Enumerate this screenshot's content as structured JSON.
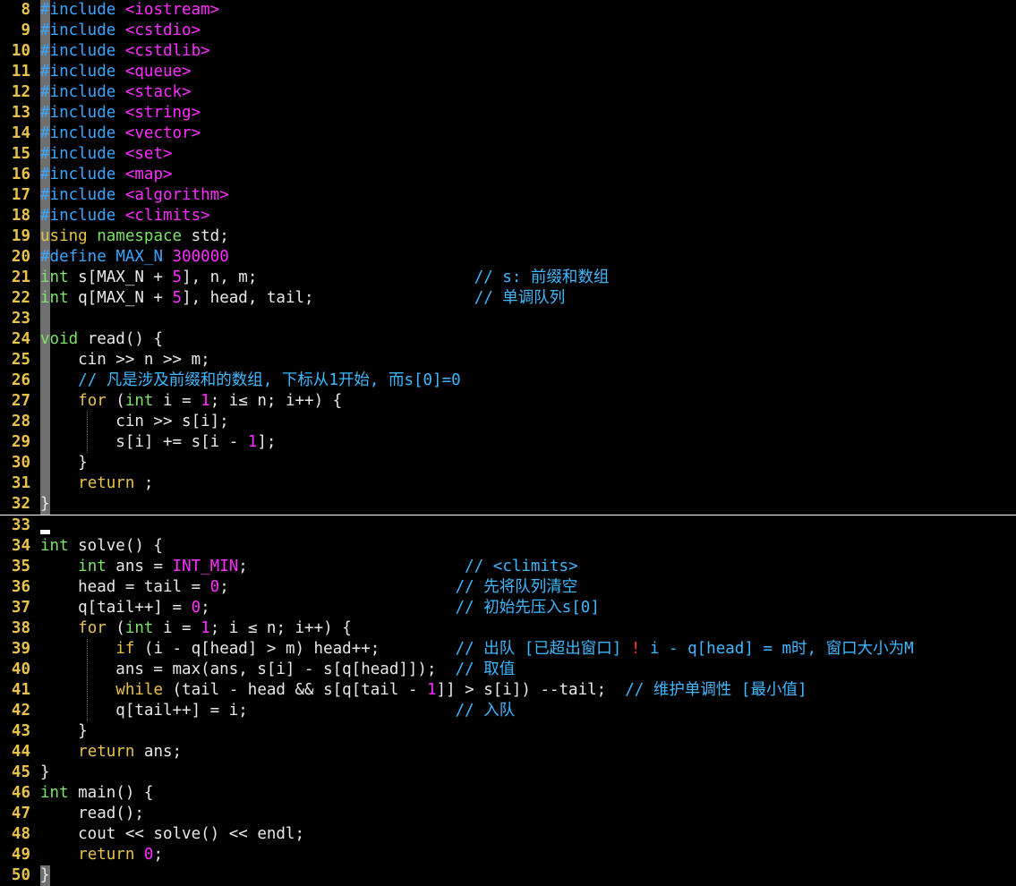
{
  "editor": {
    "language": "cpp",
    "colors": {
      "background": "#000000",
      "line_number": "#e8c24a",
      "preprocessor": "#39a6ff",
      "string_include": "#ff2cff",
      "keyword": "#e8c24a",
      "type": "#7ee36b",
      "number": "#ff2cff",
      "comment": "#3fb8ff",
      "text": "#e8e8e8",
      "gutter_mark": "#6f6f6f",
      "warning_mark": "#ff3030"
    },
    "cursor_line": 33,
    "lines": [
      {
        "n": "8",
        "gutter": true,
        "tokens": [
          [
            "pre",
            "#include"
          ],
          [
            "id",
            " "
          ],
          [
            "str",
            "<iostream>"
          ]
        ]
      },
      {
        "n": "9",
        "gutter": true,
        "tokens": [
          [
            "pre",
            "#include"
          ],
          [
            "id",
            " "
          ],
          [
            "str",
            "<cstdio>"
          ]
        ]
      },
      {
        "n": "10",
        "gutter": true,
        "tokens": [
          [
            "pre",
            "#include"
          ],
          [
            "id",
            " "
          ],
          [
            "str",
            "<cstdlib>"
          ]
        ]
      },
      {
        "n": "11",
        "gutter": true,
        "tokens": [
          [
            "pre",
            "#include"
          ],
          [
            "id",
            " "
          ],
          [
            "str",
            "<queue>"
          ]
        ]
      },
      {
        "n": "12",
        "gutter": true,
        "tokens": [
          [
            "pre",
            "#include"
          ],
          [
            "id",
            " "
          ],
          [
            "str",
            "<stack>"
          ]
        ]
      },
      {
        "n": "13",
        "gutter": true,
        "tokens": [
          [
            "pre",
            "#include"
          ],
          [
            "id",
            " "
          ],
          [
            "str",
            "<string>"
          ]
        ]
      },
      {
        "n": "14",
        "gutter": true,
        "tokens": [
          [
            "pre",
            "#include"
          ],
          [
            "id",
            " "
          ],
          [
            "str",
            "<vector>"
          ]
        ]
      },
      {
        "n": "15",
        "gutter": true,
        "tokens": [
          [
            "pre",
            "#include"
          ],
          [
            "id",
            " "
          ],
          [
            "str",
            "<set>"
          ]
        ]
      },
      {
        "n": "16",
        "gutter": true,
        "tokens": [
          [
            "pre",
            "#include"
          ],
          [
            "id",
            " "
          ],
          [
            "str",
            "<map>"
          ]
        ]
      },
      {
        "n": "17",
        "gutter": true,
        "tokens": [
          [
            "pre",
            "#include"
          ],
          [
            "id",
            " "
          ],
          [
            "str",
            "<algorithm>"
          ]
        ]
      },
      {
        "n": "18",
        "gutter": true,
        "tokens": [
          [
            "pre",
            "#include"
          ],
          [
            "id",
            " "
          ],
          [
            "str",
            "<climits>"
          ]
        ]
      },
      {
        "n": "19",
        "gutter": true,
        "tokens": [
          [
            "kw",
            "using"
          ],
          [
            "id",
            " "
          ],
          [
            "ty",
            "namespace"
          ],
          [
            "id",
            " std;"
          ]
        ]
      },
      {
        "n": "20",
        "gutter": true,
        "tokens": [
          [
            "pre",
            "#define"
          ],
          [
            "id",
            " "
          ],
          [
            "pre",
            "MAX_N"
          ],
          [
            "id",
            " "
          ],
          [
            "num",
            "300000"
          ]
        ]
      },
      {
        "n": "21",
        "gutter": true,
        "tokens": [
          [
            "ty",
            "int"
          ],
          [
            "id",
            " s[MAX_N + "
          ],
          [
            "num",
            "5"
          ],
          [
            "id",
            "], n, m;                       "
          ],
          [
            "cmt",
            "// s: 前缀和数组"
          ]
        ]
      },
      {
        "n": "22",
        "gutter": true,
        "tokens": [
          [
            "ty",
            "int"
          ],
          [
            "id",
            " q[MAX_N + "
          ],
          [
            "num",
            "5"
          ],
          [
            "id",
            "], head, tail;                 "
          ],
          [
            "cmt",
            "// 单调队列"
          ]
        ]
      },
      {
        "n": "23",
        "gutter": true,
        "tokens": []
      },
      {
        "n": "24",
        "gutter": true,
        "tokens": [
          [
            "ty",
            "void"
          ],
          [
            "id",
            " read() {"
          ]
        ]
      },
      {
        "n": "25",
        "gutter": true,
        "tokens": [
          [
            "id",
            "    cin >> n >> m;"
          ]
        ]
      },
      {
        "n": "26",
        "gutter": true,
        "tokens": [
          [
            "id",
            "    "
          ],
          [
            "cmt",
            "// 凡是涉及前缀和的数组, 下标从1开始, 而s[0]=0"
          ]
        ]
      },
      {
        "n": "27",
        "gutter": true,
        "tokens": [
          [
            "id",
            "    "
          ],
          [
            "kw",
            "for"
          ],
          [
            "id",
            " ("
          ],
          [
            "ty",
            "int"
          ],
          [
            "id",
            " i = "
          ],
          [
            "num",
            "1"
          ],
          [
            "id",
            "; i≤ n; i++) {"
          ]
        ]
      },
      {
        "n": "28",
        "gutter": true,
        "guide": true,
        "tokens": [
          [
            "id",
            "        cin >> s[i];"
          ]
        ]
      },
      {
        "n": "29",
        "gutter": true,
        "guide": true,
        "tokens": [
          [
            "id",
            "        s[i] += s[i - "
          ],
          [
            "num",
            "1"
          ],
          [
            "id",
            "];"
          ]
        ]
      },
      {
        "n": "30",
        "gutter": true,
        "tokens": [
          [
            "id",
            "    }"
          ]
        ]
      },
      {
        "n": "31",
        "gutter": true,
        "tokens": [
          [
            "id",
            "    "
          ],
          [
            "kw",
            "return"
          ],
          [
            "id",
            " ;"
          ]
        ]
      },
      {
        "n": "32",
        "gutter": true,
        "tokens": [
          [
            "id",
            "}"
          ]
        ]
      },
      {
        "n": "33",
        "gutter": false,
        "tokens": []
      },
      {
        "n": "34",
        "gutter": false,
        "tokens": [
          [
            "ty",
            "int"
          ],
          [
            "id",
            " solve() {"
          ]
        ]
      },
      {
        "n": "35",
        "gutter": false,
        "tokens": [
          [
            "id",
            "    "
          ],
          [
            "ty",
            "int"
          ],
          [
            "id",
            " ans = "
          ],
          [
            "mac",
            "INT_MIN"
          ],
          [
            "id",
            ";                       "
          ],
          [
            "cmt",
            "// <climits>"
          ]
        ]
      },
      {
        "n": "36",
        "gutter": false,
        "tokens": [
          [
            "id",
            "    head = tail = "
          ],
          [
            "num",
            "0"
          ],
          [
            "id",
            ";                        "
          ],
          [
            "cmt",
            "// 先将队列清空"
          ]
        ]
      },
      {
        "n": "37",
        "gutter": false,
        "tokens": [
          [
            "id",
            "    q[tail++] = "
          ],
          [
            "num",
            "0"
          ],
          [
            "id",
            ";                          "
          ],
          [
            "cmt",
            "// 初始先压入s[0]"
          ]
        ]
      },
      {
        "n": "38",
        "gutter": false,
        "tokens": [
          [
            "id",
            "    "
          ],
          [
            "kw",
            "for"
          ],
          [
            "id",
            " ("
          ],
          [
            "ty",
            "int"
          ],
          [
            "id",
            " i = "
          ],
          [
            "num",
            "1"
          ],
          [
            "id",
            "; i ≤ n; i++) {"
          ]
        ]
      },
      {
        "n": "39",
        "gutter": false,
        "guide": true,
        "tokens": [
          [
            "id",
            "        "
          ],
          [
            "kw",
            "if"
          ],
          [
            "id",
            " (i - q[head] > m) head++;        "
          ],
          [
            "cmt",
            "// 出队 [已超出窗口] "
          ],
          [
            "bang",
            "!"
          ],
          [
            "cmt",
            " i - q[head] = m时, 窗口大小为M"
          ]
        ]
      },
      {
        "n": "40",
        "gutter": false,
        "guide": true,
        "tokens": [
          [
            "id",
            "        ans = max(ans, s[i] - s[q[head]]);  "
          ],
          [
            "cmt",
            "// 取值"
          ]
        ]
      },
      {
        "n": "41",
        "gutter": false,
        "guide": true,
        "tokens": [
          [
            "id",
            "        "
          ],
          [
            "kw",
            "while"
          ],
          [
            "id",
            " (tail - head && s[q[tail - "
          ],
          [
            "num",
            "1"
          ],
          [
            "id",
            "]] > s[i]) --tail;  "
          ],
          [
            "cmt",
            "// 维护单调性 [最小值]"
          ]
        ]
      },
      {
        "n": "42",
        "gutter": false,
        "guide": true,
        "tokens": [
          [
            "id",
            "        q[tail++] = i;                      "
          ],
          [
            "cmt",
            "// 入队"
          ]
        ]
      },
      {
        "n": "43",
        "gutter": false,
        "tokens": [
          [
            "id",
            "    }"
          ]
        ]
      },
      {
        "n": "44",
        "gutter": false,
        "tokens": [
          [
            "id",
            "    "
          ],
          [
            "kw",
            "return"
          ],
          [
            "id",
            " ans;"
          ]
        ]
      },
      {
        "n": "45",
        "gutter": false,
        "tokens": [
          [
            "id",
            "}"
          ]
        ]
      },
      {
        "n": "46",
        "gutter": false,
        "tokens": [
          [
            "ty",
            "int"
          ],
          [
            "id",
            " main() {"
          ]
        ]
      },
      {
        "n": "47",
        "gutter": false,
        "tokens": [
          [
            "id",
            "    read();"
          ]
        ]
      },
      {
        "n": "48",
        "gutter": false,
        "tokens": [
          [
            "id",
            "    cout << solve() << endl;"
          ]
        ]
      },
      {
        "n": "49",
        "gutter": false,
        "tokens": [
          [
            "id",
            "    "
          ],
          [
            "kw",
            "return"
          ],
          [
            "id",
            " "
          ],
          [
            "num",
            "0"
          ],
          [
            "id",
            ";"
          ]
        ]
      },
      {
        "n": "50",
        "gutter": true,
        "tokens": [
          [
            "id",
            "}"
          ]
        ]
      }
    ]
  }
}
